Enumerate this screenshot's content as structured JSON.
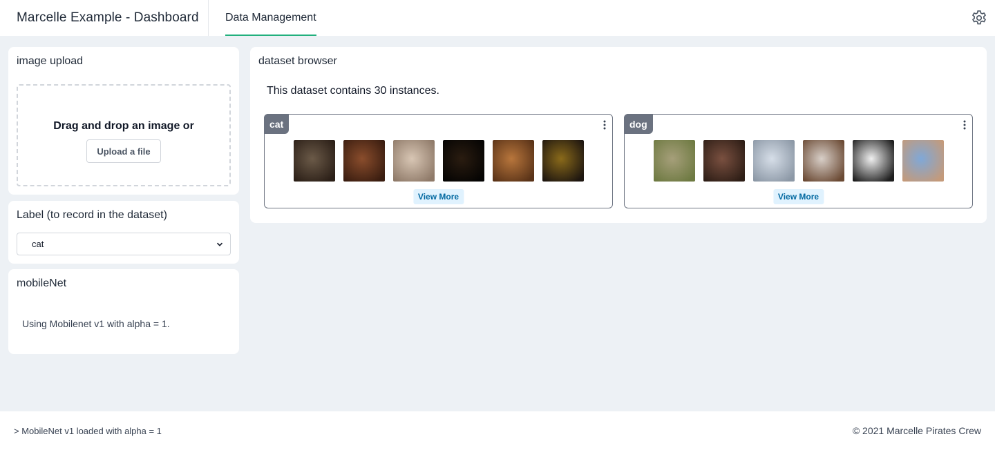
{
  "header": {
    "app_title": "Marcelle Example - Dashboard",
    "tabs": [
      {
        "label": "Data Management",
        "active": true
      }
    ],
    "settings_icon": "gear-icon",
    "accent_color": "#22b07d"
  },
  "upload": {
    "title": "image upload",
    "drop_text": "Drag and drop an image or",
    "button_label": "Upload a file"
  },
  "label": {
    "title": "Label (to record in the dataset)",
    "selected": "cat",
    "icon": "chevron-down-icon"
  },
  "mobilenet": {
    "title": "mobileNet",
    "text": "Using Mobilenet v1 with alpha = 1."
  },
  "browser": {
    "title": "dataset browser",
    "summary": "This dataset contains 30 instances.",
    "classes": [
      {
        "label": "cat",
        "view_more": "View More",
        "thumbnails": [
          {
            "name": "cat-1",
            "colors": [
              "#6b5a48",
              "#2b1f17"
            ]
          },
          {
            "name": "cat-2",
            "colors": [
              "#8a4d2c",
              "#3a1d10"
            ]
          },
          {
            "name": "cat-3",
            "colors": [
              "#d8c6b4",
              "#8f7a69"
            ]
          },
          {
            "name": "cat-4",
            "colors": [
              "#2a1c10",
              "#050403"
            ]
          },
          {
            "name": "cat-5",
            "colors": [
              "#b8763c",
              "#5a3318"
            ]
          },
          {
            "name": "cat-6",
            "colors": [
              "#8a6a1a",
              "#1e1610"
            ]
          }
        ]
      },
      {
        "label": "dog",
        "view_more": "View More",
        "thumbnails": [
          {
            "name": "dog-1",
            "colors": [
              "#a69f7a",
              "#6e7a42"
            ]
          },
          {
            "name": "dog-2",
            "colors": [
              "#7a5040",
              "#2e1e16"
            ]
          },
          {
            "name": "dog-3",
            "colors": [
              "#d6dee8",
              "#8c98a6"
            ]
          },
          {
            "name": "dog-4",
            "colors": [
              "#d8cfc8",
              "#6b4a34"
            ]
          },
          {
            "name": "dog-5",
            "colors": [
              "#f0f0f0",
              "#1e1e1e"
            ]
          },
          {
            "name": "dog-6",
            "colors": [
              "#7fa8d8",
              "#c49a7a"
            ]
          }
        ]
      }
    ]
  },
  "footer": {
    "log": "> MobileNet v1 loaded with alpha = 1",
    "copyright": "© 2021 Marcelle Pirates Crew"
  }
}
